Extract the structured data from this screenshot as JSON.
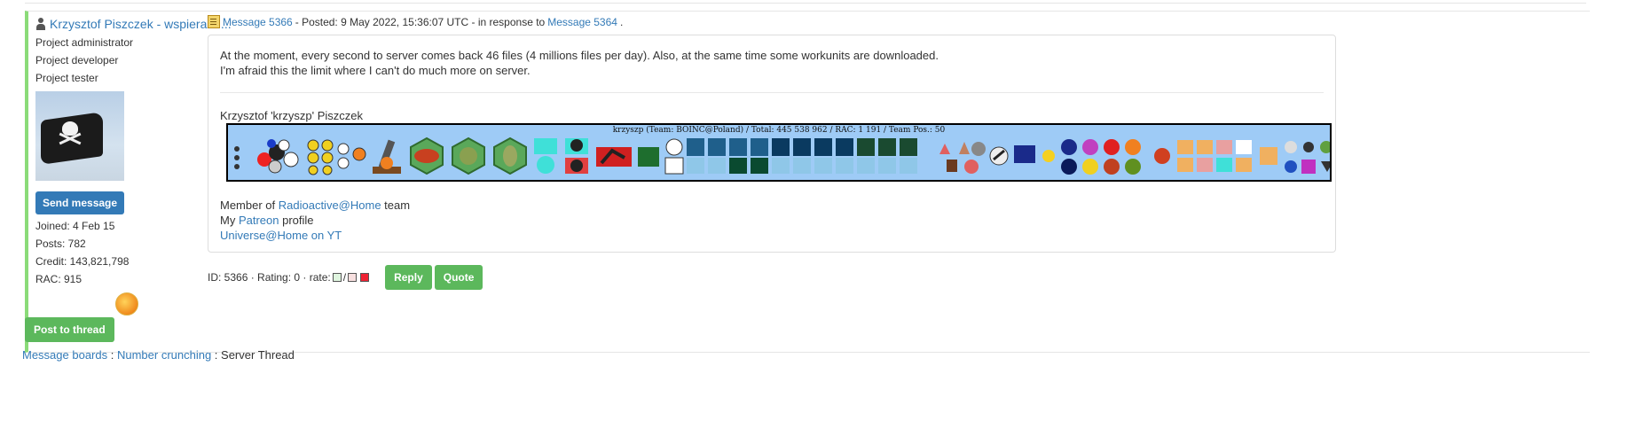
{
  "post": {
    "author": "Krzysztof Piszczek - wspieram ...",
    "roles": [
      "Project administrator",
      "Project developer",
      "Project tester"
    ],
    "send_message": "Send message",
    "stats": {
      "joined": "Joined: 4 Feb 15",
      "posts": "Posts: 782",
      "credit": "Credit: 143,821,798",
      "rac": "RAC: 915"
    },
    "header": {
      "message_link": "Message 5366",
      "posted_text": " - Posted: 9 May 2022, 15:36:07 UTC - in response to ",
      "response_link": "Message 5364",
      "end": "."
    },
    "body": {
      "line1": "At the moment, every second to server comes back 46 files (4 millions files per day). Also, at the same time some workunits are downloaded.",
      "line2": "I'm afraid this the limit where I can't do much more on server."
    },
    "signature": {
      "name": "Krzysztof 'krzyszp' Piszczek",
      "banner_title": "krzyszp (Team: BOINC@Poland) / Total: 445 538 962 / RAC: 1 191 / Team Pos.: 50",
      "member_prefix": "Member of ",
      "member_link": "Radioactive@Home",
      "member_suffix": " team",
      "patreon_prefix": "My ",
      "patreon_link": "Patreon",
      "patreon_suffix": " profile",
      "yt_link": "Universe@Home on YT"
    },
    "footer": {
      "id_rating": "ID: 5366 · Rating: 0 · rate: ",
      "slash": " / ",
      "reply": "Reply",
      "quote": "Quote"
    }
  },
  "post_to_thread": "Post to thread",
  "breadcrumb": {
    "boards": "Message boards",
    "sep1": " : ",
    "category": "Number crunching",
    "sep2": " : ",
    "thread": "Server Thread"
  },
  "colors": {
    "link": "#337ab7",
    "green_button": "#5cb85c",
    "blue_button": "#337ab7",
    "post_accent": "#8bdb79",
    "banner_bg": "#9ecbf6"
  }
}
